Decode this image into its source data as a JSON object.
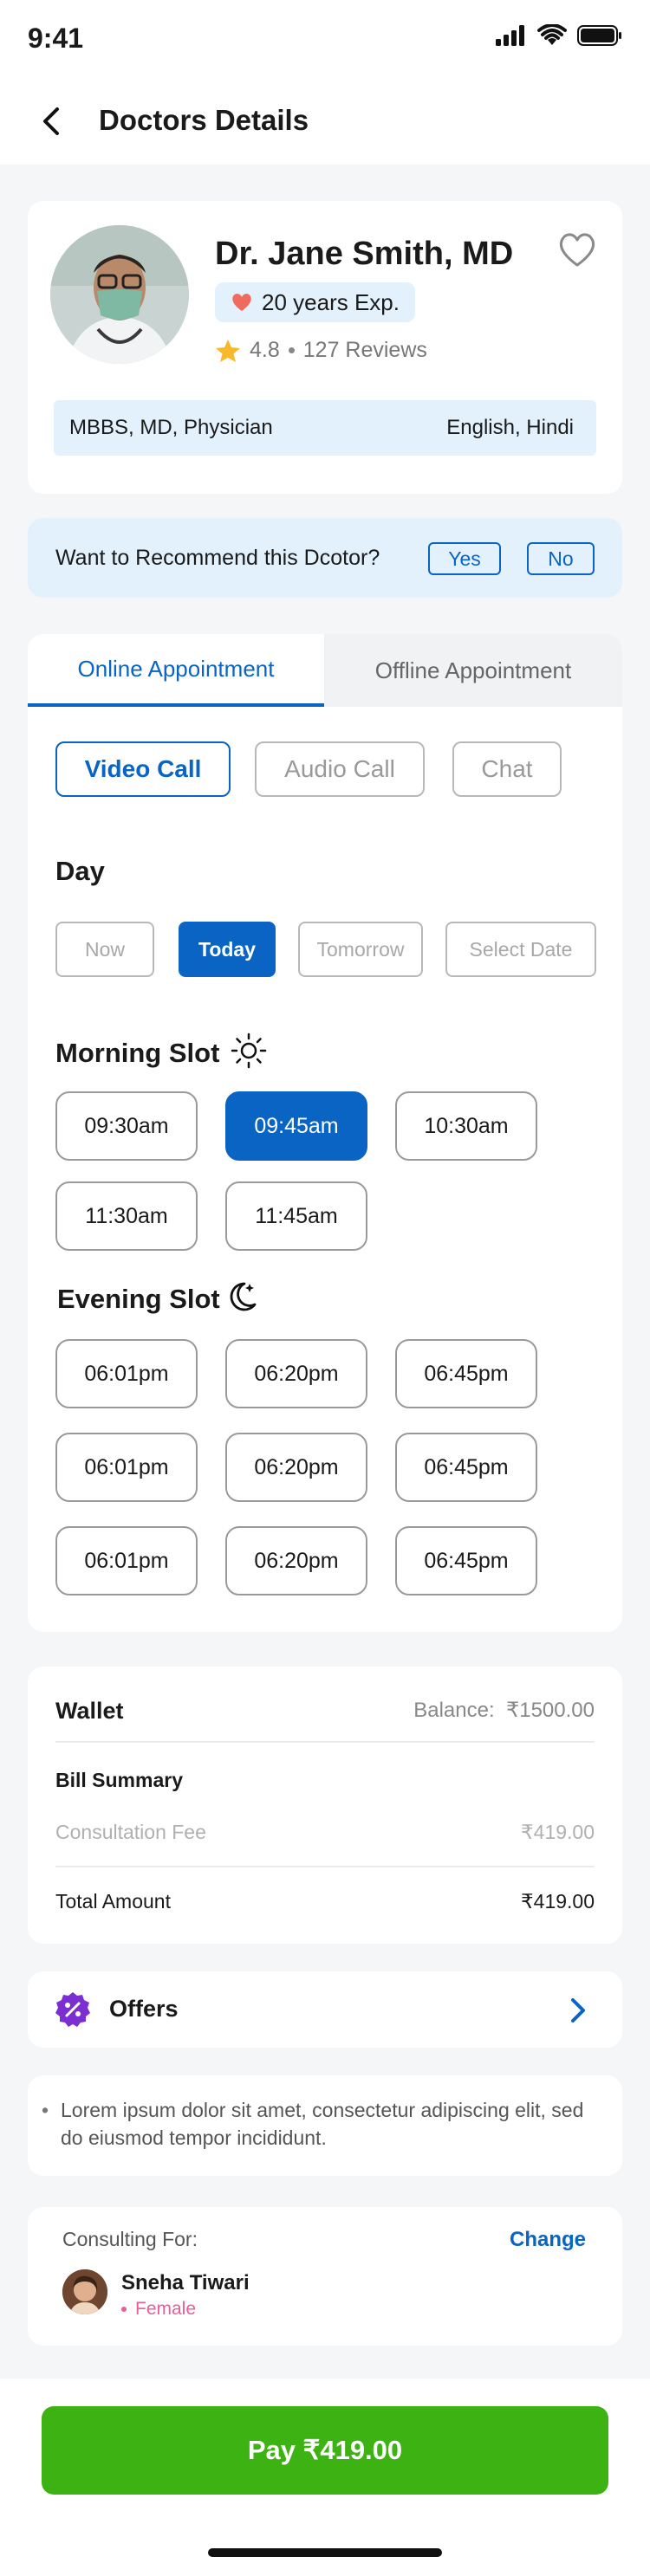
{
  "status": {
    "time": "9:41"
  },
  "header": {
    "title": "Doctors Details"
  },
  "doctor": {
    "name": "Dr. Jane Smith, MD",
    "experience": "20 years Exp.",
    "rating": "4.8",
    "reviews": "127 Reviews",
    "qualification": "MBBS, MD, Physician",
    "languages": "English, Hindi"
  },
  "recommend": {
    "question": "Want to Recommend  this Dcotor?",
    "yes": "Yes",
    "no": "No"
  },
  "appointment": {
    "tabs": [
      "Online Appointment",
      "Offline Appointment"
    ],
    "modes": [
      "Video Call",
      "Audio Call",
      "Chat"
    ],
    "day_title": "Day",
    "days": [
      "Now",
      "Today",
      "Tomorrow",
      "Select Date"
    ],
    "morning_title": "Morning Slot",
    "morning_slots": [
      "09:30am",
      "09:45am",
      "10:30am",
      "11:30am",
      "11:45am"
    ],
    "evening_title": "Evening Slot",
    "evening_slots": [
      "06:01pm",
      "06:20pm",
      "06:45pm",
      "06:01pm",
      "06:20pm",
      "06:45pm",
      "06:01pm",
      "06:20pm",
      "06:45pm"
    ]
  },
  "wallet": {
    "title": "Wallet",
    "balance_label": "Balance:",
    "balance": "₹1500.00",
    "bill_title": "Bill Summary",
    "fee_label": "Consultation Fee",
    "fee": "₹419.00",
    "total_label": "Total Amount",
    "total": "₹419.00"
  },
  "offers": {
    "label": "Offers"
  },
  "note": "Lorem ipsum dolor sit amet, consectetur adipiscing elit, sed do eiusmod tempor incididunt.",
  "consulting": {
    "label": "Consulting For:",
    "change": "Change",
    "name": "Sneha Tiwari",
    "gender": "Female"
  },
  "pay": {
    "label": "Pay ₹419.00"
  },
  "colors": {
    "primary": "#0a64c4",
    "pay": "#3cb213",
    "light_blue": "#e3f1fc",
    "gender_pink": "#e85d9a"
  }
}
